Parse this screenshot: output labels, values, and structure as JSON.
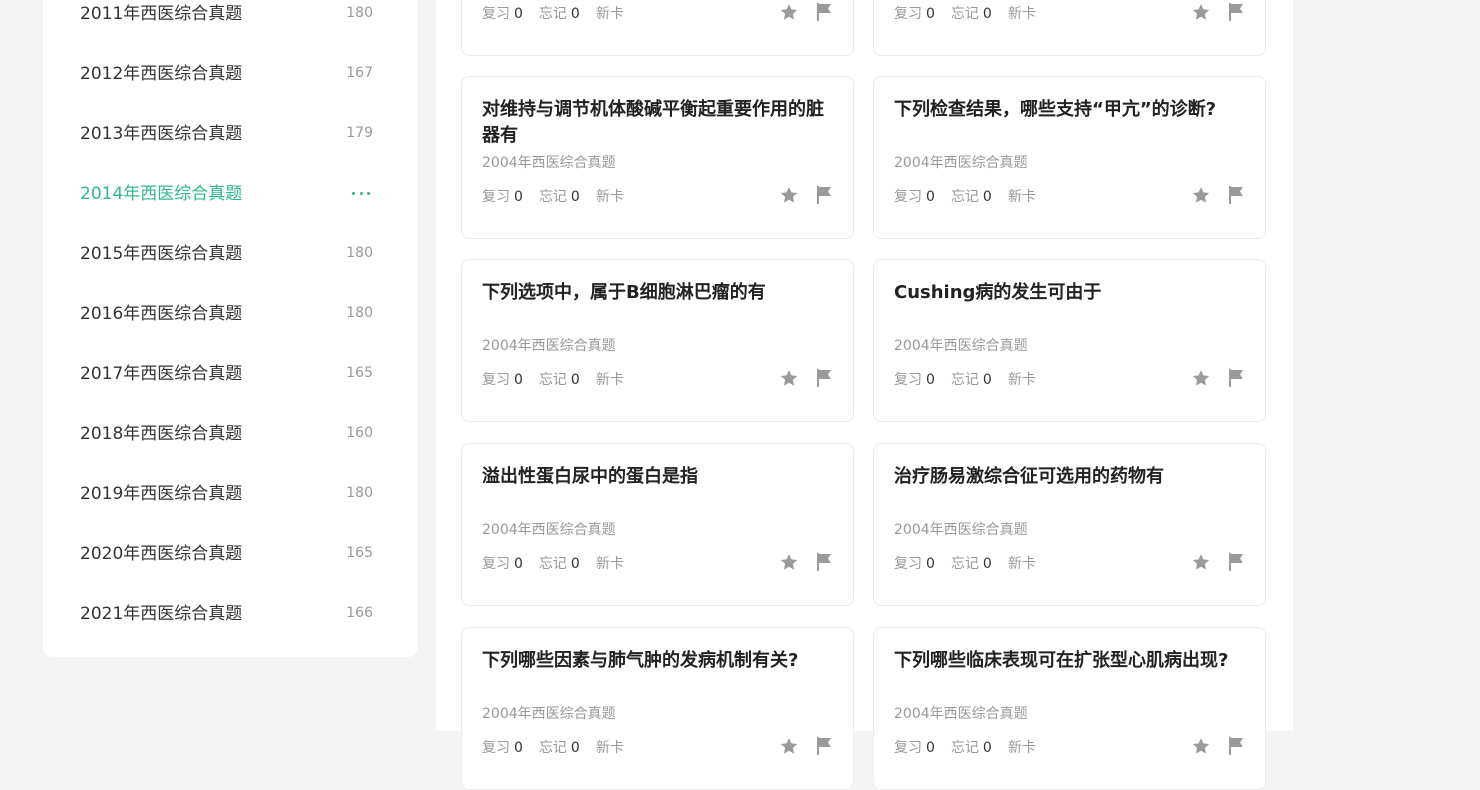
{
  "sidebar": {
    "items": [
      {
        "label": "2011年西医综合真题",
        "count": "180"
      },
      {
        "label": "2012年西医综合真题",
        "count": "167"
      },
      {
        "label": "2013年西医综合真题",
        "count": "179"
      },
      {
        "label": "2014年西医综合真题",
        "count": "",
        "active": true
      },
      {
        "label": "2015年西医综合真题",
        "count": "180"
      },
      {
        "label": "2016年西医综合真题",
        "count": "180"
      },
      {
        "label": "2017年西医综合真题",
        "count": "165"
      },
      {
        "label": "2018年西医综合真题",
        "count": "160"
      },
      {
        "label": "2019年西医综合真题",
        "count": "180"
      },
      {
        "label": "2020年西医综合真题",
        "count": "165"
      },
      {
        "label": "2021年西医综合真题",
        "count": "166"
      }
    ]
  },
  "stats_labels": {
    "review": "复习",
    "forget": "忘记",
    "new": "新卡"
  },
  "cards": [
    {
      "title": "",
      "source": "",
      "review": "0",
      "forget": "0"
    },
    {
      "title": "",
      "source": "",
      "review": "0",
      "forget": "0"
    },
    {
      "title": "对维持与调节机体酸碱平衡起重要作用的脏器有",
      "source": "2004年西医综合真题",
      "review": "0",
      "forget": "0"
    },
    {
      "title": "下列检查结果，哪些支持“甲亢”的诊断?",
      "source": "2004年西医综合真题",
      "review": "0",
      "forget": "0"
    },
    {
      "title": "下列选项中，属于B细胞淋巴瘤的有",
      "source": "2004年西医综合真题",
      "review": "0",
      "forget": "0"
    },
    {
      "title": "Cushing病的发生可由于",
      "source": "2004年西医综合真题",
      "review": "0",
      "forget": "0"
    },
    {
      "title": "溢出性蛋白尿中的蛋白是指",
      "source": "2004年西医综合真题",
      "review": "0",
      "forget": "0"
    },
    {
      "title": "治疗肠易激综合征可选用的药物有",
      "source": "2004年西医综合真题",
      "review": "0",
      "forget": "0"
    },
    {
      "title": "下列哪些因素与肺气肿的发病机制有关?",
      "source": "2004年西医综合真题",
      "review": "0",
      "forget": "0"
    },
    {
      "title": "下列哪些临床表现可在扩张型心肌病出现?",
      "source": "2004年西医综合真题",
      "review": "0",
      "forget": "0"
    }
  ],
  "colors": {
    "accent": "#2eb88f",
    "icon": "#9a9a9a"
  },
  "icons": {
    "star": "star-icon",
    "flag": "flag-icon",
    "more": "more-icon"
  }
}
